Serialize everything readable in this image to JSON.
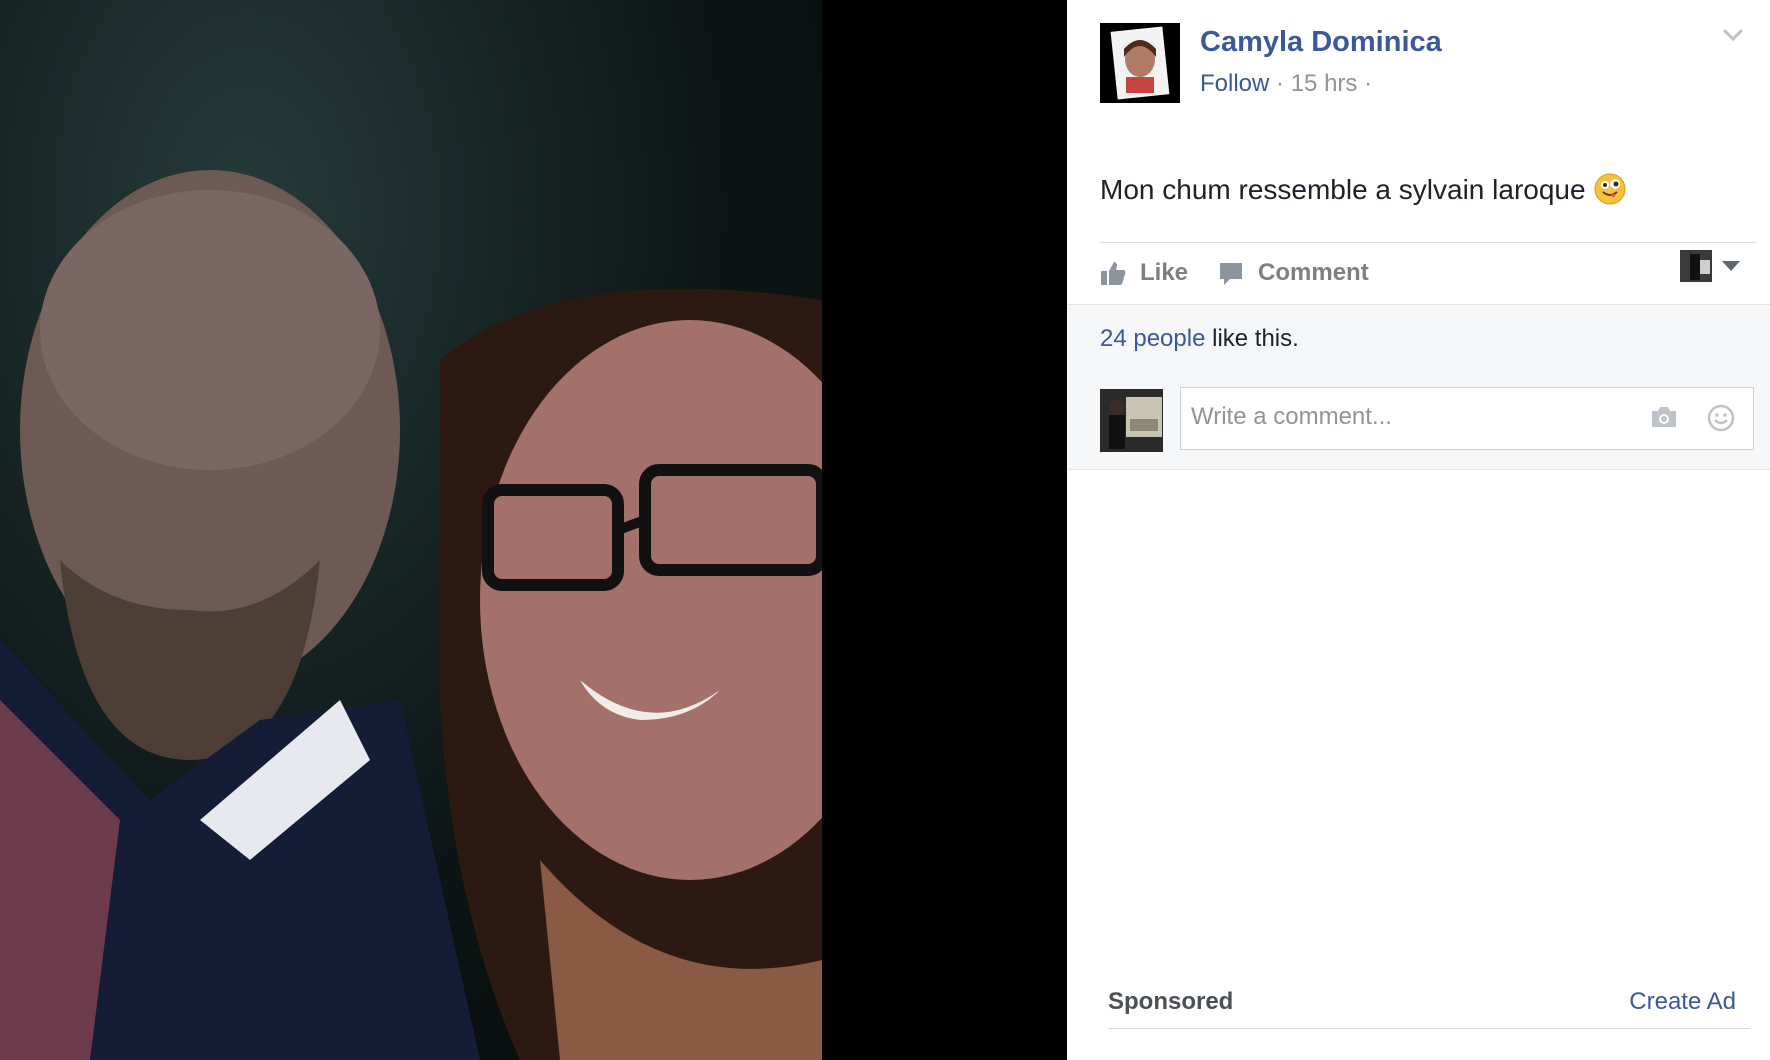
{
  "post": {
    "author": "Camyla Dominica",
    "follow_label": "Follow",
    "separator": "·",
    "timestamp": "15 hrs",
    "trailing_separator": "·",
    "text": "Mon chum ressemble a sylvain laroque",
    "emoji": "winking-face-with-tongue"
  },
  "actions": {
    "like_label": "Like",
    "comment_label": "Comment"
  },
  "likes": {
    "count_link": "24 people",
    "suffix": "like this."
  },
  "comment_box": {
    "placeholder": "Write a comment..."
  },
  "sponsored": {
    "label": "Sponsored",
    "create_ad": "Create Ad"
  },
  "colors": {
    "link": "#3b5998",
    "muted": "#90949c",
    "panel_bg": "#f6f7f9"
  },
  "icons": [
    "chevron-down-icon",
    "like-thumb-icon",
    "comment-bubble-icon",
    "camera-icon",
    "smiley-icon",
    "caret-down-icon"
  ]
}
